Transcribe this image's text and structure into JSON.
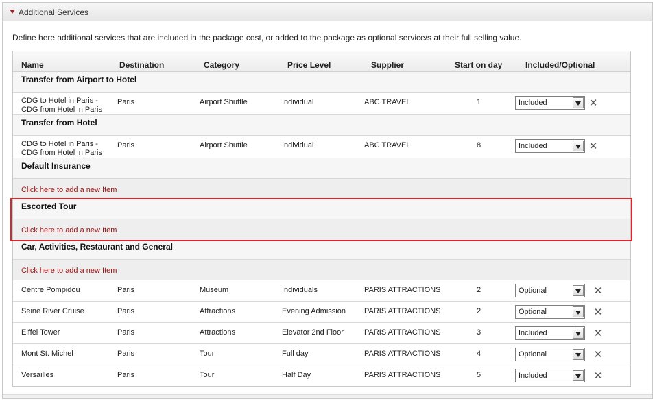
{
  "panel": {
    "title": "Additional Services"
  },
  "intro": "Define here additional services that are included in the package cost, or added to the package as optional service/s at their full selling value.",
  "columns": {
    "name": "Name",
    "destination": "Destination",
    "category": "Category",
    "price_level": "Price Level",
    "supplier": "Supplier",
    "start_day": "Start on day",
    "included": "Included/Optional"
  },
  "add_item_label": "Click here to add a new Item",
  "groups": [
    {
      "title": "Transfer from Airport to Hotel",
      "items": [
        {
          "name": "CDG to Hotel in Paris - CDG from Hotel in Paris",
          "destination": "Paris",
          "category": "Airport Shuttle",
          "price_level": "Individual",
          "supplier": "ABC TRAVEL",
          "start_day": "1",
          "included": "Included"
        }
      ]
    },
    {
      "title": "Transfer from Hotel",
      "items": [
        {
          "name": "CDG to Hotel in Paris - CDG from Hotel in Paris",
          "destination": "Paris",
          "category": "Airport Shuttle",
          "price_level": "Individual",
          "supplier": "ABC TRAVEL",
          "start_day": "8",
          "included": "Included"
        }
      ]
    },
    {
      "title": "Default Insurance",
      "items": []
    },
    {
      "title": "Escorted Tour",
      "items": [],
      "highlighted": true
    },
    {
      "title": "Car, Activities, Restaurant and General",
      "items": [
        {
          "name": "Centre Pompidou",
          "destination": "Paris",
          "category": "Museum",
          "price_level": "Individuals",
          "supplier": "PARIS ATTRACTIONS",
          "start_day": "2",
          "included": "Optional"
        },
        {
          "name": "Seine River Cruise",
          "destination": "Paris",
          "category": "Attractions",
          "price_level": "Evening Admission",
          "supplier": "PARIS ATTRACTIONS",
          "start_day": "2",
          "included": "Optional"
        },
        {
          "name": "Eiffel Tower",
          "destination": "Paris",
          "category": "Attractions",
          "price_level": "Elevator 2nd Floor",
          "supplier": "PARIS ATTRACTIONS",
          "start_day": "3",
          "included": "Included"
        },
        {
          "name": "Mont St. Michel",
          "destination": "Paris",
          "category": "Tour",
          "price_level": "Full day",
          "supplier": "PARIS ATTRACTIONS",
          "start_day": "4",
          "included": "Optional"
        },
        {
          "name": "Versailles",
          "destination": "Paris",
          "category": "Tour",
          "price_level": "Half Day",
          "supplier": "PARIS ATTRACTIONS",
          "start_day": "5",
          "included": "Included"
        }
      ]
    }
  ],
  "icons": {
    "collapse": "collapse-triangle-icon",
    "dropdown": "chevron-down-icon",
    "delete": "close-icon"
  },
  "colors": {
    "link": "#a11313",
    "highlight": "#d9262c"
  }
}
